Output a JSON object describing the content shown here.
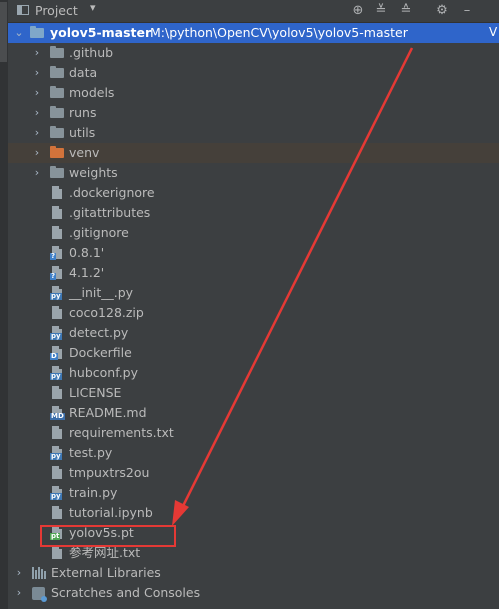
{
  "panel": {
    "title": "Project",
    "side_tab_label": "Project"
  },
  "toolbar": {
    "buttons": [
      {
        "name": "locate-icon",
        "glyph": "⊕"
      },
      {
        "name": "expand-all-icon",
        "glyph": "≚"
      },
      {
        "name": "collapse-all-icon",
        "glyph": "≙"
      },
      {
        "name": "settings-icon",
        "glyph": "⚙"
      },
      {
        "name": "hide-icon",
        "glyph": "–"
      }
    ]
  },
  "tree": {
    "root": {
      "name": "yolov5-master",
      "path": "M:\\python\\OpenCV\\yolov5\\yolov5-master"
    },
    "folders": [
      ".github",
      "data",
      "models",
      "runs",
      "utils",
      "venv",
      "weights"
    ],
    "files": [
      {
        "name": ".dockerignore",
        "tag": ""
      },
      {
        "name": ".gitattributes",
        "tag": ""
      },
      {
        "name": ".gitignore",
        "tag": ""
      },
      {
        "name": "0.8.1'",
        "tag": "?"
      },
      {
        "name": "4.1.2'",
        "tag": "?"
      },
      {
        "name": "__init__.py",
        "tag": "py"
      },
      {
        "name": "coco128.zip",
        "tag": ""
      },
      {
        "name": "detect.py",
        "tag": "py"
      },
      {
        "name": "Dockerfile",
        "tag": "D"
      },
      {
        "name": "hubconf.py",
        "tag": "py"
      },
      {
        "name": "LICENSE",
        "tag": ""
      },
      {
        "name": "README.md",
        "tag": "MD"
      },
      {
        "name": "requirements.txt",
        "tag": ""
      },
      {
        "name": "test.py",
        "tag": "py"
      },
      {
        "name": "tmpuxtrs2ou",
        "tag": ""
      },
      {
        "name": "train.py",
        "tag": "py"
      },
      {
        "name": "tutorial.ipynb",
        "tag": ""
      },
      {
        "name": "yolov5s.pt",
        "tag": "pt"
      },
      {
        "name": "参考网址.txt",
        "tag": ""
      }
    ],
    "bottom": [
      "External Libraries",
      "Scratches and Consoles"
    ]
  },
  "colors": {
    "background": "#3c3f41",
    "selection": "#2f65ca",
    "venv_highlight": "#45403a",
    "annotation_red": "#e53935"
  }
}
